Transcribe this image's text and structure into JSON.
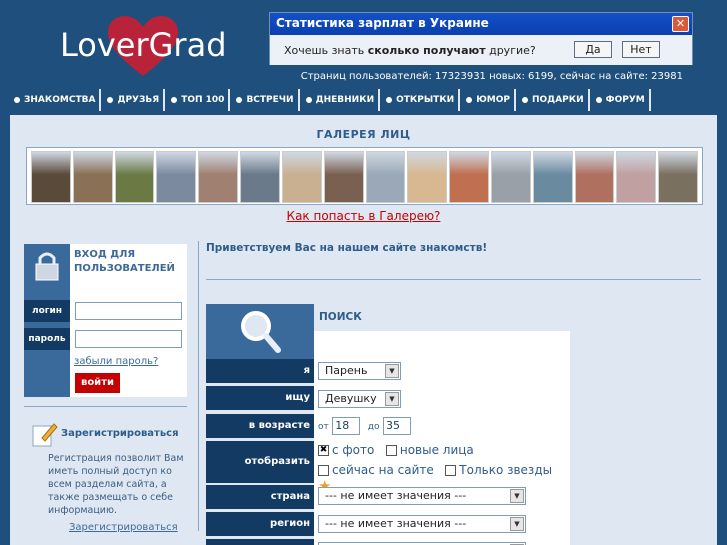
{
  "header": {
    "logo_text": "LoverGrad",
    "stats": "Страниц пользователей: 17323931 новых: 6199, сейчас на сайте: 23981"
  },
  "popup": {
    "title": "Статистика зарплат в Украине",
    "question_prefix": "Хочешь знать ",
    "question_bold": "сколько получают",
    "question_suffix": " другие?",
    "yes_label": "Да",
    "no_label": "Нет"
  },
  "nav": {
    "items": [
      "ЗНАКОМСТВА",
      "ДРУЗЬЯ",
      "ТОП 100",
      "ВСТРЕЧИ",
      "ДНЕВНИКИ",
      "ОТКРЫТКИ",
      "ЮМОР",
      "ПОДАРКИ",
      "ФОРУМ"
    ]
  },
  "gallery": {
    "title": "ГАЛЕРЕЯ ЛИЦ",
    "link": "Как попасть в Галерею?",
    "face_colors": [
      "#5a4a3a",
      "#8a7055",
      "#6b7a45",
      "#7c8aa0",
      "#a08070",
      "#6a7a8a",
      "#c8b090",
      "#7a6050",
      "#9aa8b8",
      "#d8b890",
      "#c07050",
      "#9aa0a8",
      "#6a8aa0",
      "#b07060",
      "#c0a0a0",
      "#7a7060"
    ]
  },
  "login": {
    "title": "ВХОД ДЛЯ ПОЛЬЗОВАТЕЛЕЙ",
    "login_label": "логин",
    "password_label": "пароль",
    "forgot": "забыли пароль?",
    "button": "войти"
  },
  "register": {
    "title": "Зарегистрироваться",
    "description": "Регистрация позволит Вам иметь полный доступ ко всем разделам сайта, а также размещать о себе информацию.",
    "link": "Зарегистрироваться"
  },
  "main": {
    "welcome": "Приветствуем Вас на нашем сайте знакомств!"
  },
  "search": {
    "title": "ПОИСК",
    "i_label": "я",
    "i_value": "Парень",
    "seek_label": "ищу",
    "seek_value": "Девушку",
    "age_label": "в возрасте",
    "age_from_label": "от",
    "age_from": "18",
    "age_to_label": "до",
    "age_to": "35",
    "show_label": "отобразить только",
    "with_photo": "с фото",
    "new_faces": "новые лица",
    "online_now": "сейчас на сайте",
    "stars_only": "Только звезды",
    "country_label": "страна",
    "country_value": "--- не имеет значения ---",
    "region_label": "регион",
    "region_value": "--- не имеет значения ---"
  }
}
